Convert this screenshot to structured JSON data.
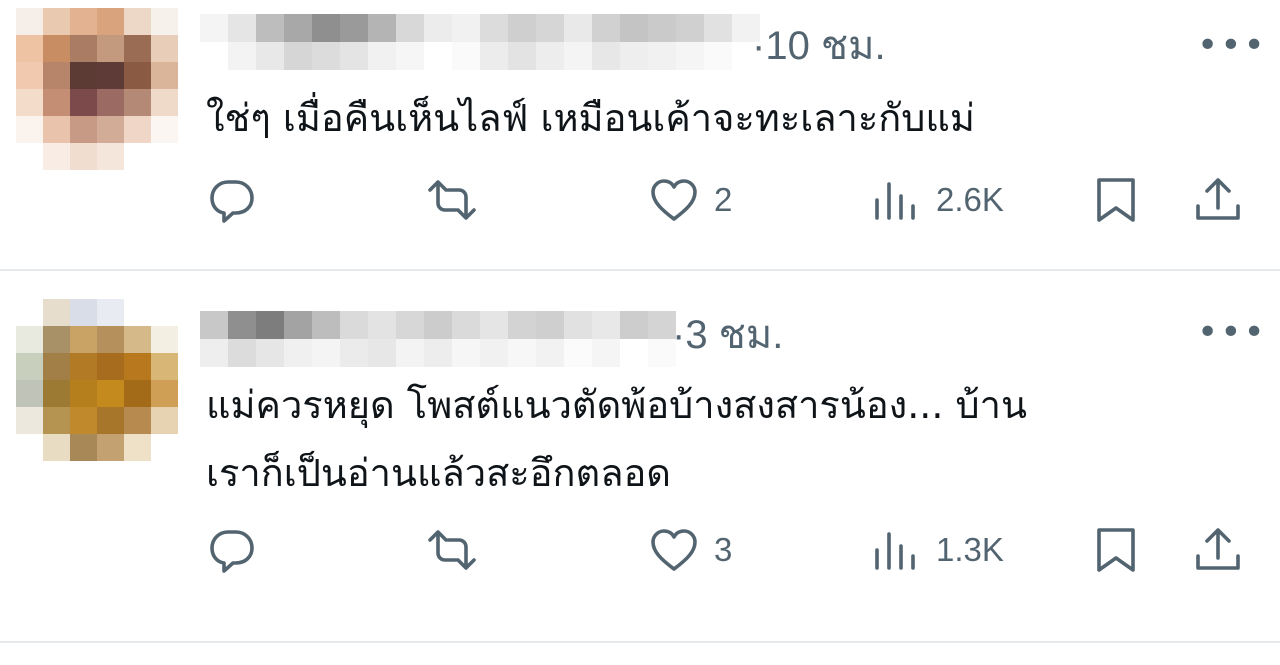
{
  "posts": [
    {
      "time": "·10 ชม.",
      "more": "•••",
      "text": "ใช่ๆ เมื่อคืนเห็นไลฟ์ เหมือนเค้าจะทะเลาะกับแม่",
      "likes": "2",
      "views": "2.6K"
    },
    {
      "time": "·3 ชม.",
      "more": "•••",
      "text": "แม่ควรหยุด โพสต์แนวตัดพ้อบ้างสงสารน้อง... บ้าน\nเราก็เป็นอ่านแล้วสะอึกตลอด",
      "likes": "3",
      "views": "1.3K"
    }
  ],
  "icons": {
    "reply": "reply-icon",
    "retweet": "retweet-icon",
    "like": "heart-icon",
    "views": "views-icon",
    "bookmark": "bookmark-icon",
    "share": "share-icon"
  },
  "colors": {
    "text": "#0f1419",
    "secondary": "#536471",
    "divider": "#e6e9ec"
  }
}
